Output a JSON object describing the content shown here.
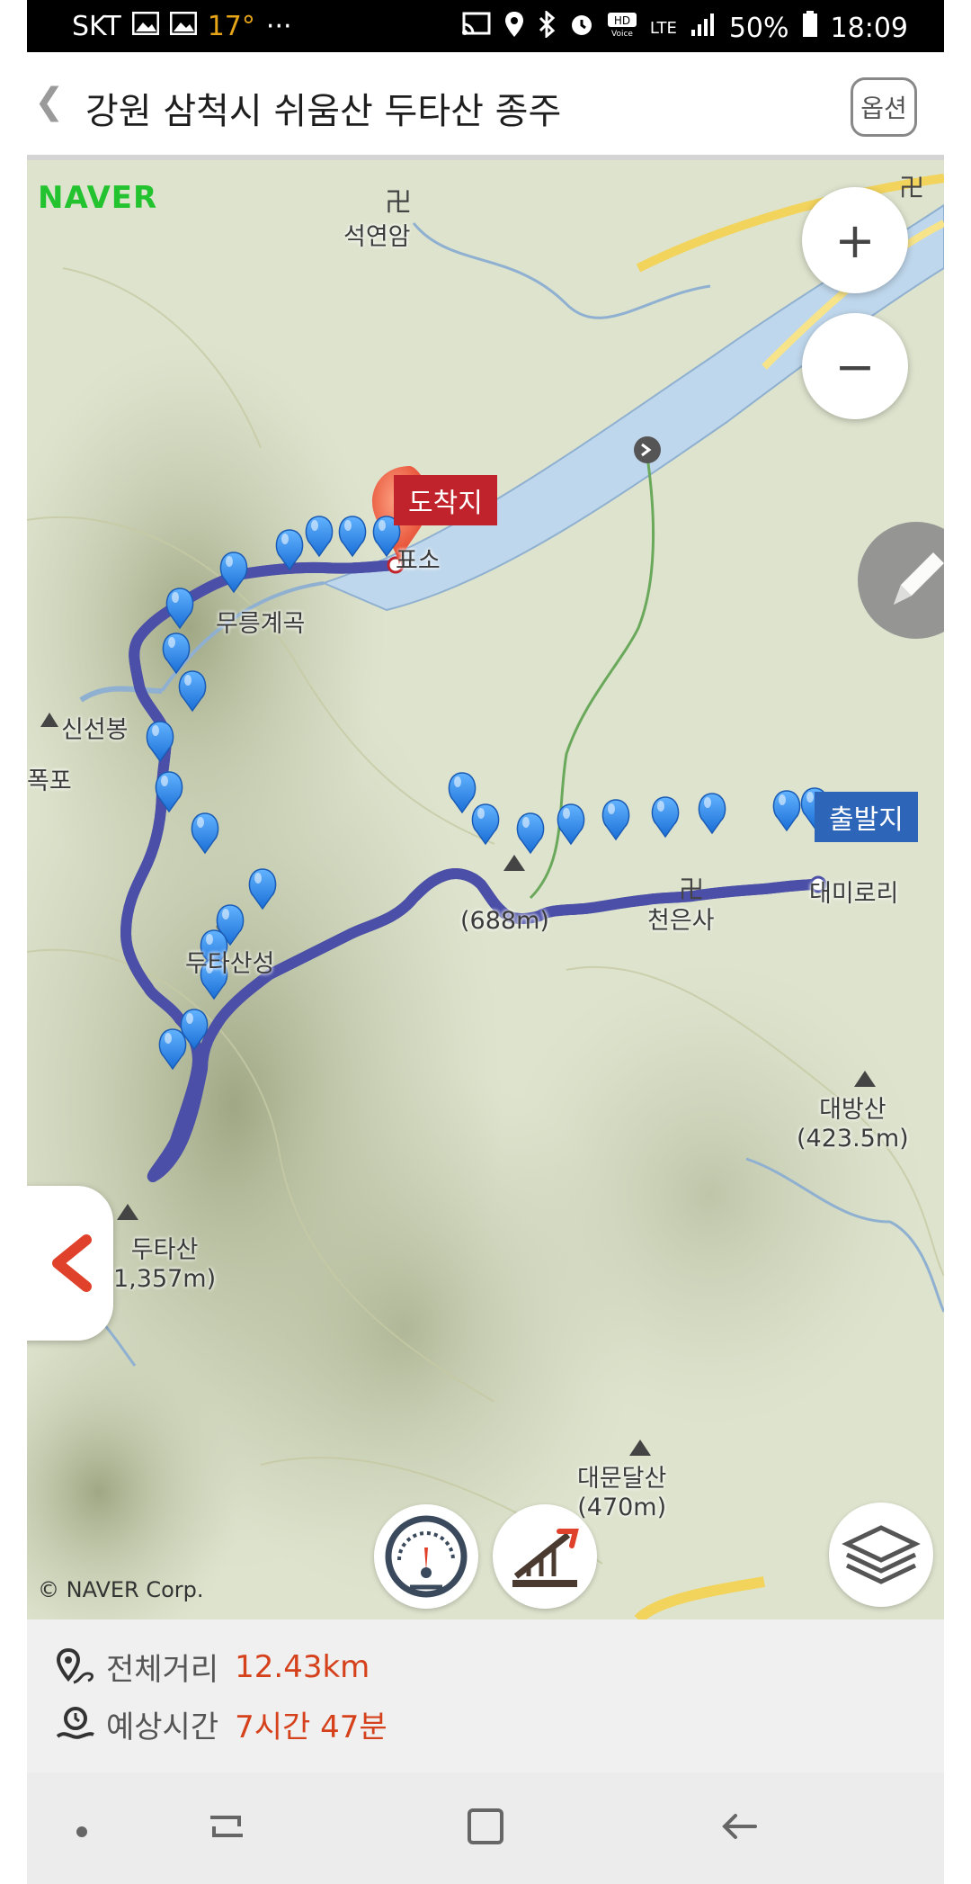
{
  "status_bar": {
    "carrier": "SKT",
    "temperature": "17°",
    "more": "···",
    "network": "LTE",
    "battery": "50%",
    "time": "18:09"
  },
  "header": {
    "back_icon": "chevron-left-icon",
    "title": "강원 삼척시 쉬움산 두타산 종주",
    "options_label": "옵션"
  },
  "map": {
    "brand": "NAVER",
    "copyright": "© NAVER Corp.",
    "zoom_in": "+",
    "zoom_out": "−",
    "end_tag": "도착지",
    "start_tag": "출발지",
    "labels": {
      "seokyeonam": "석연암",
      "mureung": "무릉계곡",
      "sinseonbong": "신선봉",
      "pok": "폭포",
      "dutasanseong": "두타산성",
      "dutasan": "두타산",
      "dutasan_alt": "1,357m)",
      "peak688": "(688m)",
      "cheoneunsa": "천은사",
      "daemirori": "대미로리",
      "daebangsan": "대방산",
      "daebangsan_alt": "(423.5m)",
      "daemundalsan": "대문달산",
      "daemundalsan_alt": "(470m)",
      "pyoso": "표소"
    },
    "icons": {
      "speedometer": "speedometer-icon",
      "elevation": "elevation-profile-icon",
      "layers": "layers-icon",
      "pen": "pen-icon",
      "collapse": "chevron-left-icon"
    }
  },
  "summary": {
    "distance_label": "전체거리",
    "distance_value": "12.43km",
    "time_label": "예상시간",
    "time_value": "7시간 47분"
  },
  "colors": {
    "accent_red": "#d5411b",
    "end_tag": "#c0232b",
    "start_tag": "#2d66b8",
    "route": "#4a4fa8",
    "naver_green": "#22c32e"
  }
}
